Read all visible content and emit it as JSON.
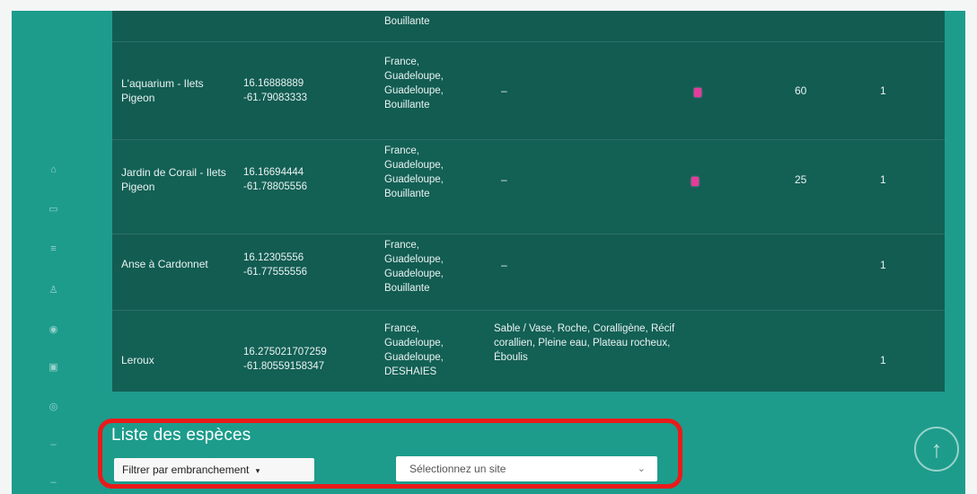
{
  "table": {
    "top_partial_country": "Bouillante",
    "rows": [
      {
        "name": "L'aquarium - Ilets Pigeon",
        "lat": "16.16888889",
        "lon": "-61.79083333",
        "country": "France, Guadeloupe, Guadeloupe, Bouillante",
        "habitat": "–",
        "depth": "60",
        "count": "1",
        "has_badge": true
      },
      {
        "name": "Jardin de Corail - Ilets Pigeon",
        "lat": "16.16694444",
        "lon": "-61.78805556",
        "country": "France, Guadeloupe, Guadeloupe, Bouillante",
        "habitat": "–",
        "depth": "25",
        "count": "1",
        "has_badge": true
      },
      {
        "name": "Anse à Cardonnet",
        "lat": "16.12305556",
        "lon": "-61.77555556",
        "country": "France, Guadeloupe, Guadeloupe, Bouillante",
        "habitat": "–",
        "depth": "",
        "count": "1",
        "has_badge": false
      },
      {
        "name": "Leroux",
        "lat": "16.275021707259",
        "lon": "-61.80559158347",
        "country": "France, Guadeloupe, Guadeloupe, DESHAIES",
        "habitat": "Sable / Vase, Roche, Coralligène, Récif corallien, Pleine eau, Plateau rocheux, Éboulis",
        "depth": "",
        "count": "1",
        "has_badge": false
      }
    ]
  },
  "species": {
    "title": "Liste des espèces",
    "filter_label": "Filtrer par embranchement",
    "filter_caret": "▾",
    "site_select_placeholder": "Sélectionnez un site",
    "site_select_chevron": "⌄"
  },
  "icons": {
    "scroll_top": "arrow-up-icon",
    "badge_color": "#e43c9b"
  },
  "colors": {
    "teal": "#1d9c8c",
    "table_dark": "#125c52",
    "highlight": "#ea1a1a"
  }
}
